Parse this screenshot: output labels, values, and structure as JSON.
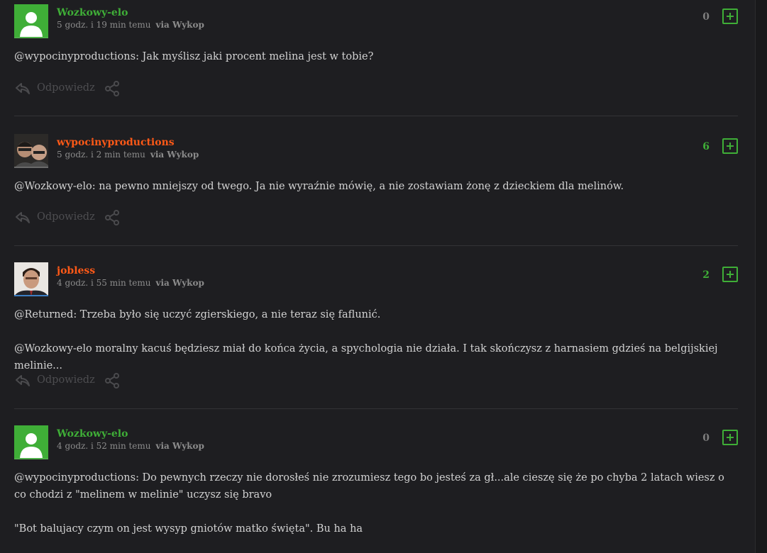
{
  "comments": [
    {
      "author": "Wozkowy-elo",
      "author_color": "#3fae37",
      "avatar": "default-user-avatar",
      "time": "5 godz. i 19 min temu",
      "via": "via Wykop",
      "votes": "0",
      "paragraphs": [
        {
          "mention": "@wypocinyproductions",
          "text": ": Jak myślisz jaki procent melina jest w tobie?"
        }
      ],
      "reply_label": "Odpowiedz"
    },
    {
      "author": "wypocinyproductions",
      "author_color": "#ff5917",
      "avatar": "photo-avatar-two-men",
      "time": "5 godz. i 2 min temu",
      "via": "via Wykop",
      "votes": "6",
      "paragraphs": [
        {
          "mention": "@Wozkowy-elo",
          "text": ": na pewno mniejszy od twego. Ja nie wyraźnie mówię, a nie zostawiam żonę z dzieckiem dla melinów."
        }
      ],
      "reply_label": "Odpowiedz"
    },
    {
      "author": "jobless",
      "author_color": "#ff5917",
      "avatar": "photo-avatar-man-suit",
      "time": "4 godz. i 55 min temu",
      "via": "via Wykop",
      "votes": "2",
      "paragraphs": [
        {
          "mention": "@Returned",
          "text": ": Trzeba było się uczyć zgierskiego, a nie teraz się faflunić."
        },
        {
          "mention": "@Wozkowy-elo",
          "text": " moralny kacuś będziesz miał do końca życia, a spychologia nie działa. I tak skończysz z harnasiem gdzieś na belgijskiej melinie..."
        }
      ],
      "reply_label": "Odpowiedz"
    },
    {
      "author": "Wozkowy-elo",
      "author_color": "#3fae37",
      "avatar": "default-user-avatar",
      "time": "4 godz. i 52 min temu",
      "via": "via Wykop",
      "votes": "0",
      "paragraphs": [
        {
          "mention": "@wypocinyproductions",
          "text": ": Do pewnych rzeczy nie dorosłeś nie zrozumiesz tego bo jesteś za gł...ale cieszę się że po chyba 2 latach wiesz o co chodzi z \"melinem w melinie\" uczysz się bravo"
        },
        {
          "mention": "",
          "text": "\"Bot balujacy czym on jest wysyp gniotów matko święta\". Bu ha ha"
        }
      ],
      "reply_label": ""
    }
  ],
  "icons": {
    "reply": "reply-arrow-icon",
    "share": "share-icon",
    "upvote": "plus-icon"
  },
  "colors": {
    "background": "#1e1e21",
    "green_user": "#3fae37",
    "orange_user": "#ff5917",
    "vote_positive": "#3fae37",
    "vote_zero": "#7d7d7d"
  }
}
